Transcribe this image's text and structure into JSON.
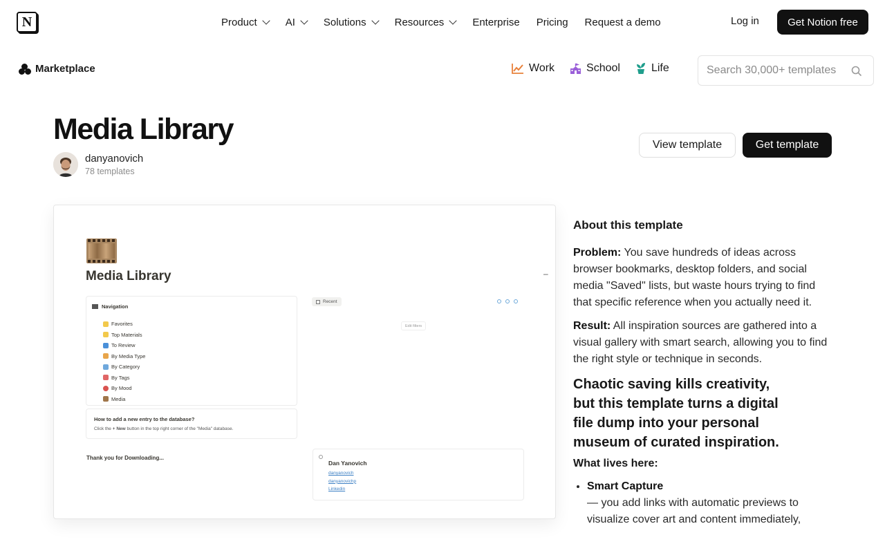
{
  "nav": {
    "logo": "N",
    "items": [
      {
        "label": "Product",
        "dropdown": true
      },
      {
        "label": "AI",
        "dropdown": true
      },
      {
        "label": "Solutions",
        "dropdown": true
      },
      {
        "label": "Resources",
        "dropdown": true
      },
      {
        "label": "Enterprise",
        "dropdown": false
      },
      {
        "label": "Pricing",
        "dropdown": false
      },
      {
        "label": "Request a demo",
        "dropdown": false
      }
    ],
    "login": "Log in",
    "cta": "Get Notion free"
  },
  "marketplace": {
    "label": "Marketplace",
    "categories": [
      {
        "label": "Work",
        "icon": "chart-up-icon",
        "color": "#e8803a"
      },
      {
        "label": "School",
        "icon": "school-icon",
        "color": "#9a5fd8"
      },
      {
        "label": "Life",
        "icon": "plant-icon",
        "color": "#1f9e8c"
      }
    ],
    "search_placeholder": "Search 30,000+ templates"
  },
  "template": {
    "title": "Media Library",
    "author": "danyanovich",
    "author_count": "78 templates",
    "view_button": "View template",
    "get_button": "Get template"
  },
  "preview": {
    "title": "Media Library",
    "collapse": "–",
    "nav_heading": "Navigation",
    "nav_items": [
      {
        "label": "Favorites",
        "color": "#f2c94c"
      },
      {
        "label": "Top Materials",
        "color": "#f2c94c"
      },
      {
        "label": "To Review",
        "color": "#4a90d9"
      },
      {
        "label": "By Media Type",
        "color": "#e8a54b"
      },
      {
        "label": "By Category",
        "color": "#6fa8dc"
      },
      {
        "label": "By Tags",
        "color": "#e06666"
      },
      {
        "label": "By Mood",
        "color": "#d9534f"
      },
      {
        "label": "Media",
        "color": "#a0764a"
      }
    ],
    "help_question": "How to add a new entry to the database?",
    "help_answer_pre": "Click the ",
    "help_answer_bold": "+ New",
    "help_answer_post": " button in the top right corner of the \"Media\" database.",
    "thanks": "Thank you for Downloading...",
    "recent_label": "Recent",
    "filters_label": "Edit filters",
    "card_name": "Dan Yanovich",
    "card_links": [
      "danyanovich",
      "danyanovichp",
      "Linkedin"
    ]
  },
  "about": {
    "heading": "About this template",
    "problem_label": "Problem:",
    "problem_text": " You save hundreds of ideas across browser bookmarks, desktop folders, and social media \"Saved\" lists, but waste hours trying to find that specific reference when you actually need it.",
    "result_label": "Result:",
    "result_text": " All inspiration sources are gathered into a visual gallery with smart search, allowing you to find the right style or technique in seconds.",
    "tagline": "Chaotic saving kills creativity, but this template turns a digital file dump into your personal museum of curated inspiration.",
    "lives_heading": "What lives here:",
    "features": [
      {
        "name": "Smart Capture",
        "text": " — you add links with automatic previews to visualize cover art and content immediately,"
      }
    ]
  }
}
